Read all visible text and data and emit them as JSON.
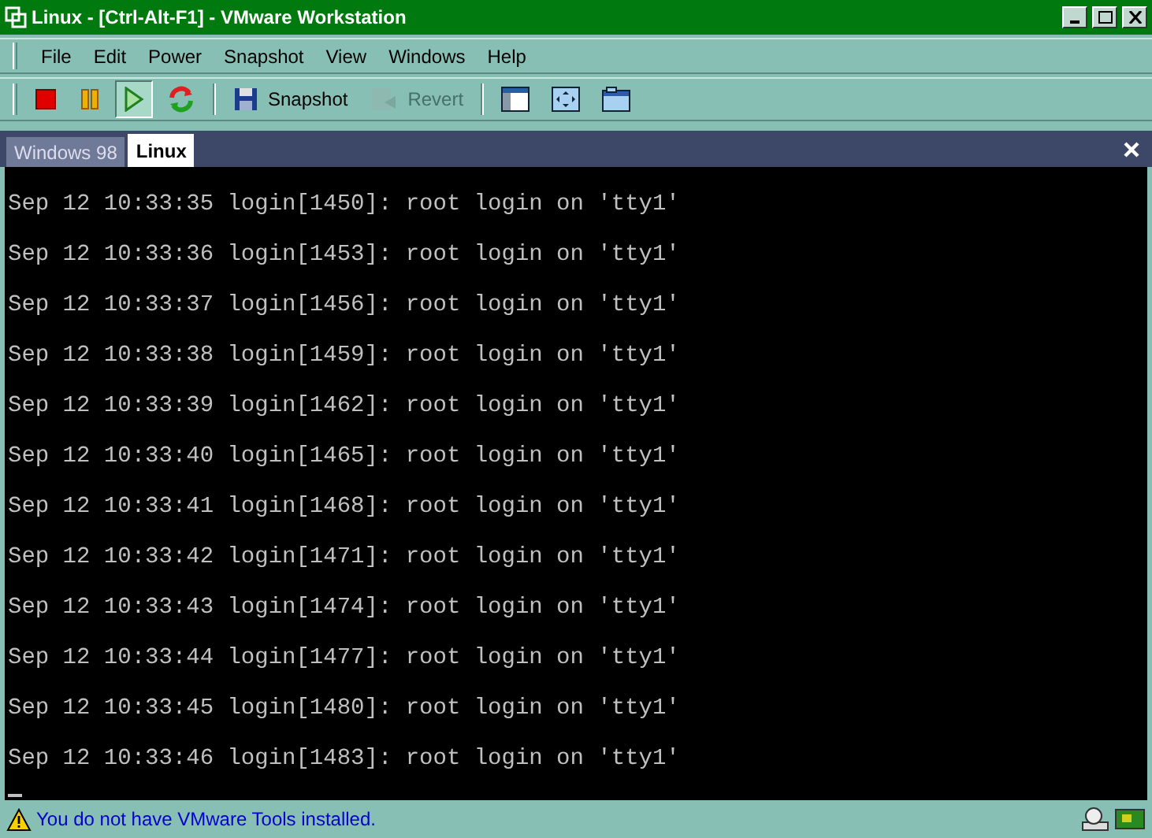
{
  "window": {
    "title": "Linux - [Ctrl-Alt-F1] - VMware Workstation"
  },
  "menu": [
    "File",
    "Edit",
    "Power",
    "Snapshot",
    "View",
    "Windows",
    "Help"
  ],
  "toolbar": [
    {
      "kind": "stop",
      "pressed": false,
      "disabled": false
    },
    {
      "kind": "pause",
      "pressed": false,
      "disabled": false
    },
    {
      "kind": "play",
      "pressed": true,
      "disabled": false
    },
    {
      "kind": "reset",
      "pressed": false,
      "disabled": false
    },
    {
      "kind": "separator"
    },
    {
      "kind": "snapshot",
      "label": "Snapshot",
      "pressed": false,
      "disabled": false
    },
    {
      "kind": "revert",
      "label": "Revert",
      "pressed": false,
      "disabled": true
    },
    {
      "kind": "separator"
    },
    {
      "kind": "sidebar",
      "pressed": false,
      "disabled": false
    },
    {
      "kind": "fullscreen",
      "pressed": false,
      "disabled": false
    },
    {
      "kind": "window",
      "pressed": false,
      "disabled": false
    }
  ],
  "tabs": [
    {
      "label": "Windows 98",
      "selected": false
    },
    {
      "label": "Linux",
      "selected": true
    }
  ],
  "console": {
    "lines": [
      "Sep 12 10:33:35 login[1450]: root login on 'tty1'",
      "Sep 12 10:33:36 login[1453]: root login on 'tty1'",
      "Sep 12 10:33:37 login[1456]: root login on 'tty1'",
      "Sep 12 10:33:38 login[1459]: root login on 'tty1'",
      "Sep 12 10:33:39 login[1462]: root login on 'tty1'",
      "Sep 12 10:33:40 login[1465]: root login on 'tty1'",
      "Sep 12 10:33:41 login[1468]: root login on 'tty1'",
      "Sep 12 10:33:42 login[1471]: root login on 'tty1'",
      "Sep 12 10:33:43 login[1474]: root login on 'tty1'",
      "Sep 12 10:33:44 login[1477]: root login on 'tty1'",
      "Sep 12 10:33:45 login[1480]: root login on 'tty1'",
      "Sep 12 10:33:46 login[1483]: root login on 'tty1'"
    ]
  },
  "status_bar": {
    "message": "You do not have VMware Tools installed."
  }
}
